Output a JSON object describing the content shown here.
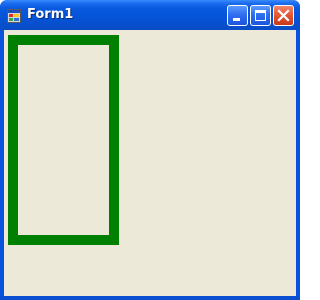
{
  "window": {
    "title": "Form1",
    "icon": "form-app-icon",
    "controls": [
      "minimize-icon",
      "maximize-icon",
      "close-icon"
    ]
  },
  "canvas": {
    "shape": "rectangle",
    "outline_color": "#008000",
    "background_color": "#ece9d8"
  },
  "theme": {
    "titlebar_color": "#0a54d8",
    "close_button_color": "#e25a35"
  }
}
